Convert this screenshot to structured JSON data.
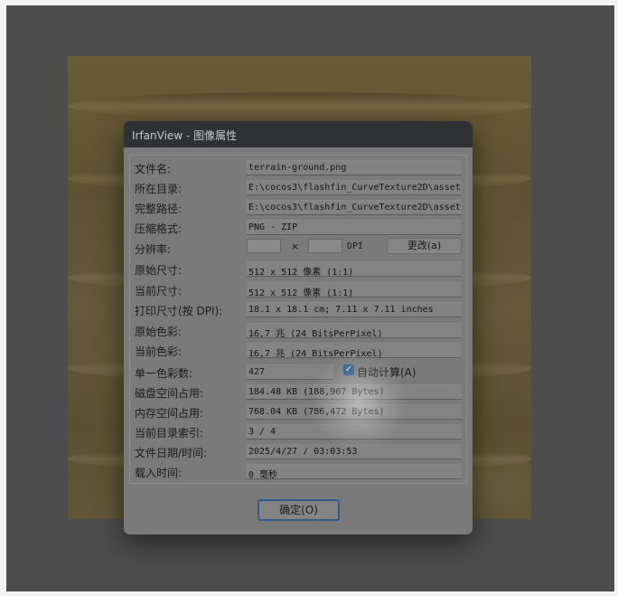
{
  "window": {
    "title": "IrfanView - 图像属性"
  },
  "properties": [
    {
      "key": "filename",
      "label": "文件名:",
      "value": "terrain-ground.png"
    },
    {
      "key": "directory",
      "label": "所在目录:",
      "value": "E:\\cocos3\\flashfin_CurveTexture2D\\asset"
    },
    {
      "key": "fullpath",
      "label": "完整路径:",
      "value": "E:\\cocos3\\flashfin_CurveTexture2D\\asset"
    },
    {
      "key": "compression",
      "label": "压缩格式:",
      "value": "PNG - ZIP"
    },
    {
      "key": "resolution",
      "label": "分辨率:"
    },
    {
      "key": "original_size",
      "label": "原始尺寸:",
      "value": "512 x 512  像素 (1:1)"
    },
    {
      "key": "current_size",
      "label": "当前尺寸:",
      "value": "512 x 512  像素 (1:1)"
    },
    {
      "key": "print_size",
      "label": "打印尺寸(按 DPI):",
      "value": "18.1 x 18.1 cm; 7.11 x 7.11 inches"
    },
    {
      "key": "original_colors",
      "label": "原始色彩:",
      "value": "16,7 兆   (24 BitsPerPixel)"
    },
    {
      "key": "current_colors",
      "label": "当前色彩:",
      "value": "16,7 兆   (24 BitsPerPixel)"
    },
    {
      "key": "unique_colors",
      "label": "单一色彩数:",
      "value": "427"
    },
    {
      "key": "disk_size",
      "label": "磁盘空间占用:",
      "value": "184.48 KB (188,907 Bytes)"
    },
    {
      "key": "memory_size",
      "label": "内存空间占用:",
      "value": "768.04  KB (786,472 Bytes)"
    },
    {
      "key": "dir_index",
      "label": "当前目录索引:",
      "value": "3  /  4"
    },
    {
      "key": "file_date",
      "label": "文件日期/时间:",
      "value": "2025/4/27 / 03:03:53"
    },
    {
      "key": "load_time",
      "label": "载入时间:",
      "value": "0 毫秒"
    }
  ],
  "resolution": {
    "x_value": "",
    "y_value": "",
    "separator": "×",
    "unit": "DPI",
    "change_button": "更改(a)"
  },
  "auto_calc": {
    "label": "自动计算(A)",
    "checked": true
  },
  "buttons": {
    "ok": "确定(O)"
  }
}
